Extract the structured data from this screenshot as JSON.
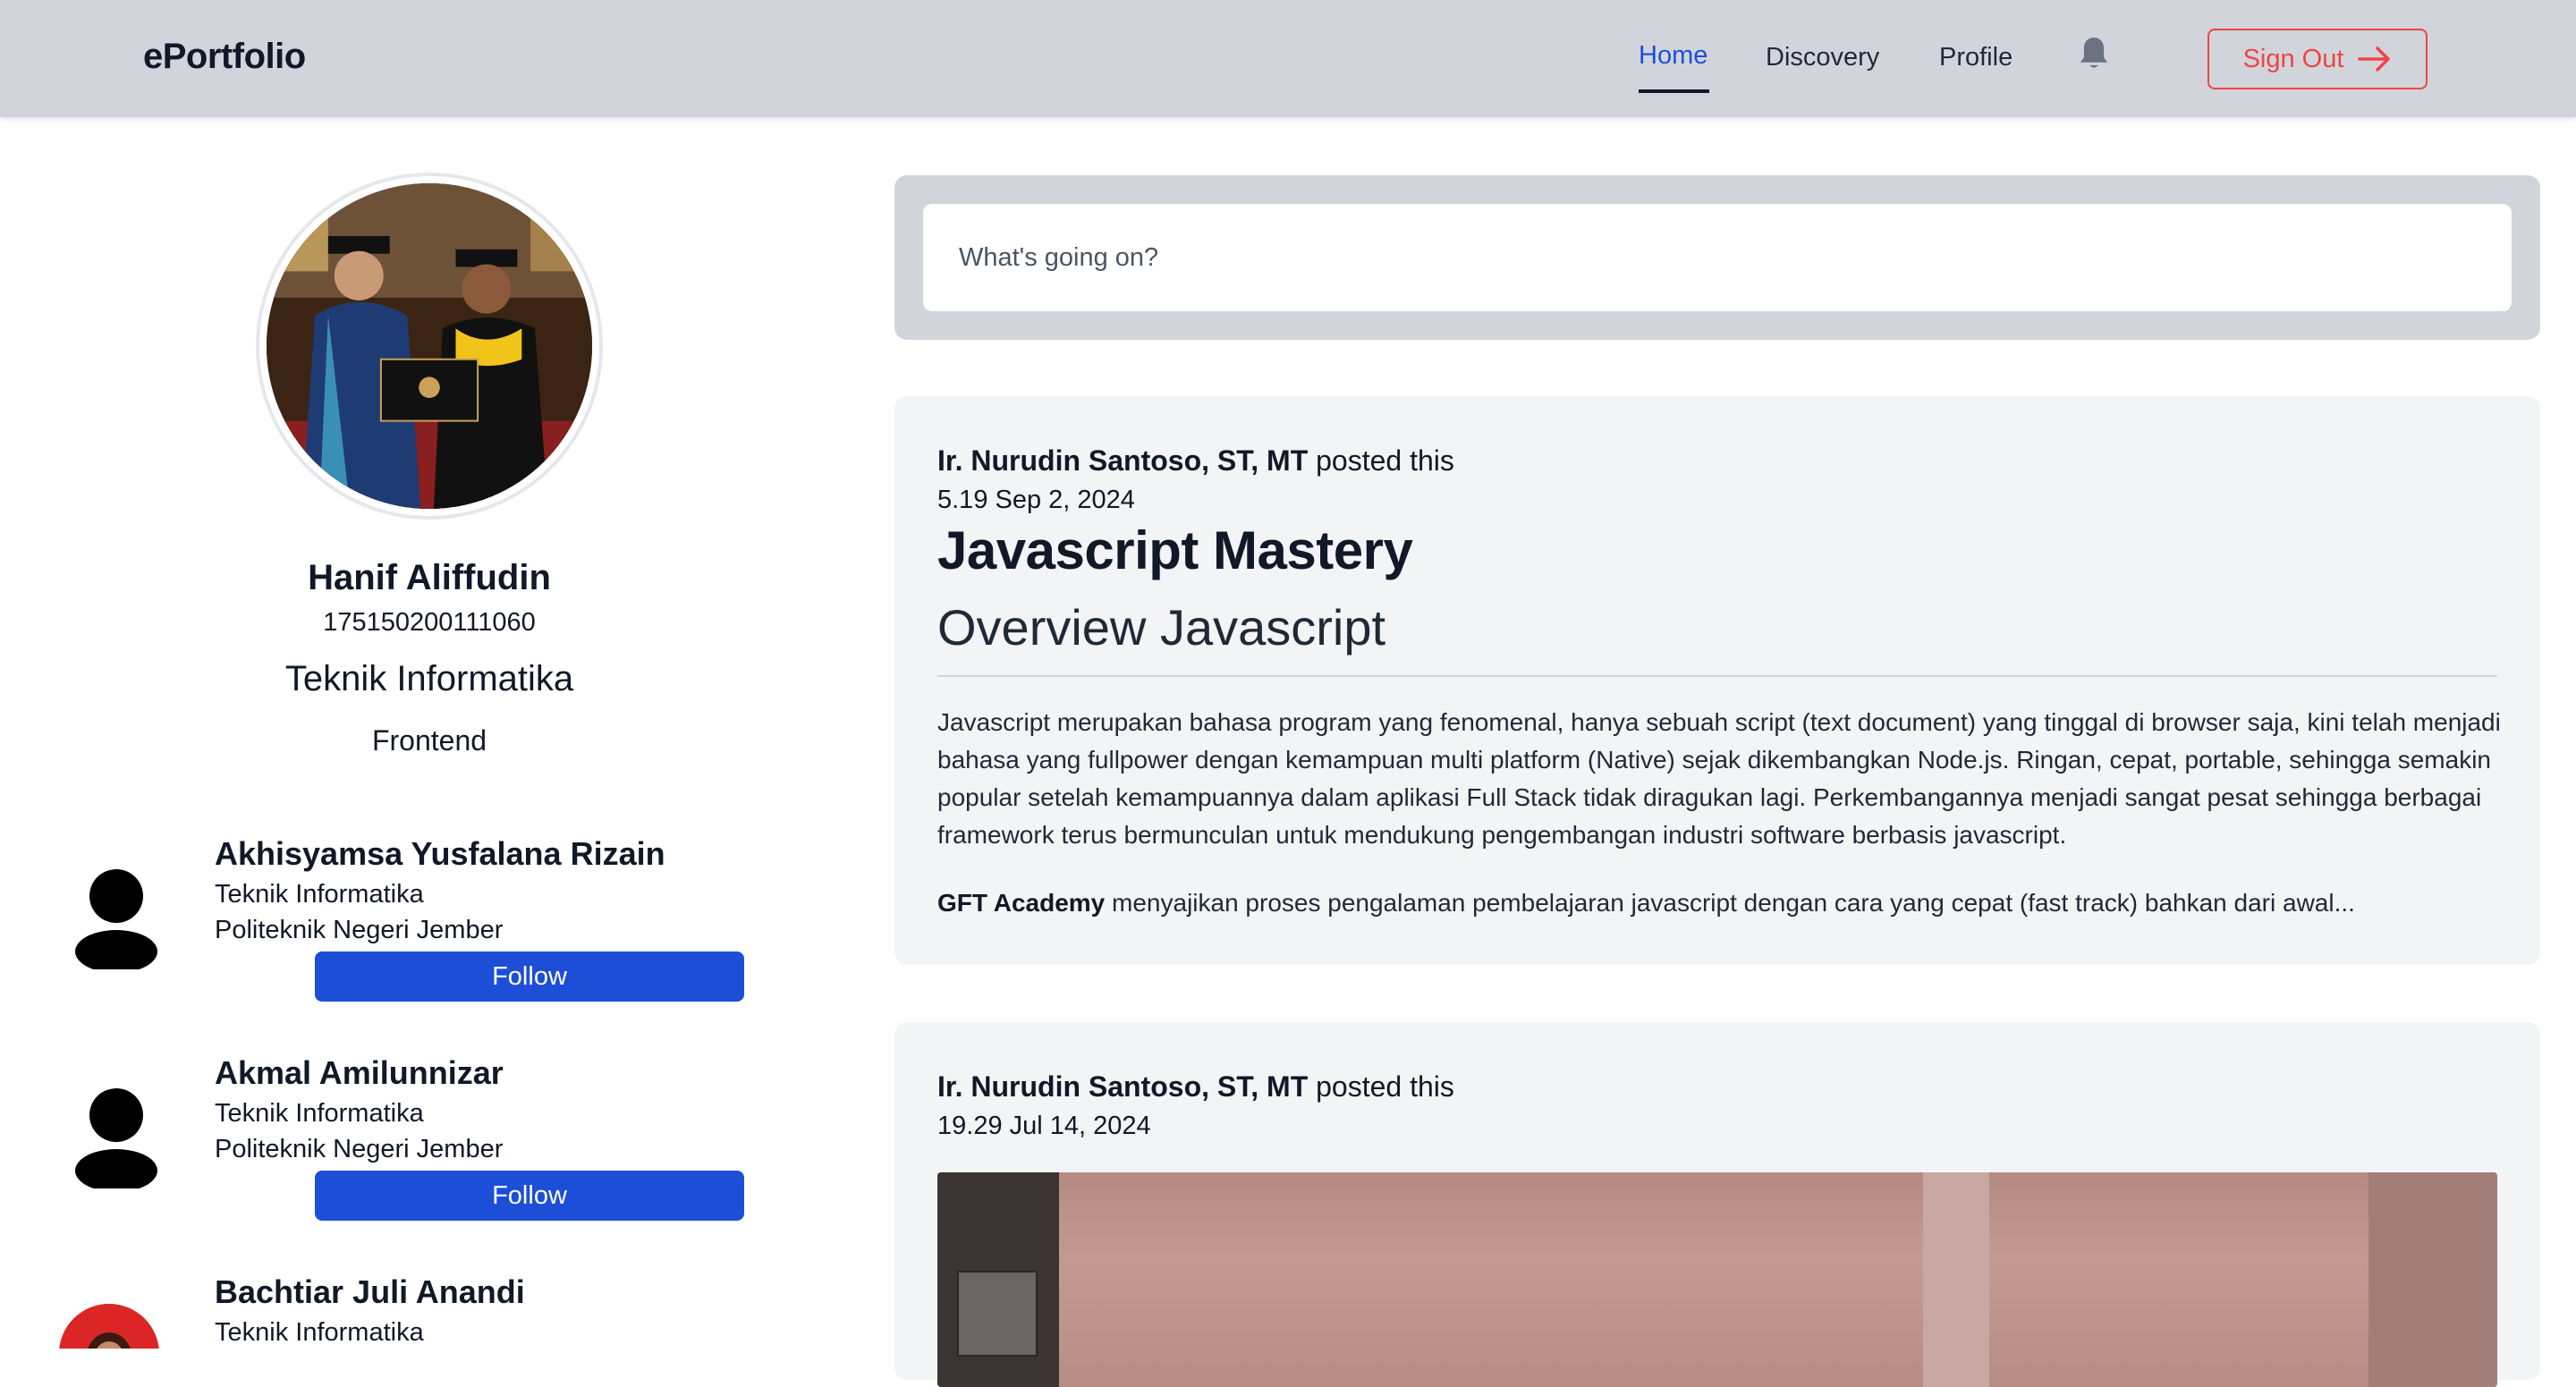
{
  "brand": "ePortfolio",
  "nav": {
    "home": "Home",
    "discovery": "Discovery",
    "profile": "Profile",
    "signout": "Sign Out"
  },
  "colors": {
    "navbar_bg": "#d1d5db",
    "accent": "#1d4ed8",
    "danger": "#ef4444",
    "card_bg": "#f3f4f6"
  },
  "profile": {
    "name": "Hanif Aliffudin",
    "nim": "175150200111060",
    "department": "Teknik Informatika",
    "role": "Frontend"
  },
  "suggestions": [
    {
      "name": "Akhisyamsa Yusfalana Rizain",
      "department": "Teknik Informatika",
      "school": "Politeknik Negeri Jember",
      "button": "Follow",
      "avatar": "default-user-icon"
    },
    {
      "name": "Akmal Amilunnizar",
      "department": "Teknik Informatika",
      "school": "Politeknik Negeri Jember",
      "button": "Follow",
      "avatar": "default-user-icon"
    },
    {
      "name": "Bachtiar Juli Anandi",
      "department": "Teknik Informatika",
      "avatar": "photo"
    }
  ],
  "composer": {
    "placeholder": "What's going on?"
  },
  "posts": [
    {
      "author": "Ir. Nurudin Santoso, ST, MT",
      "action": "posted this",
      "time": "5.19 Sep 2, 2024",
      "title": "Javascript Mastery",
      "subtitle": "Overview Javascript",
      "body": "Javascript merupakan bahasa program yang fenomenal, hanya sebuah script (text document) yang tinggal di browser saja, kini telah menjadi bahasa yang fullpower dengan kemampuan multi platform (Native) sejak dikembangkan Node.js. Ringan, cepat, portable, sehingga semakin popular setelah kemampuannya dalam aplikasi Full Stack tidak diragukan lagi. Perkembangannya menjadi sangat pesat sehingga berbagai framework terus bermunculan untuk mendukung pengembangan industri software berbasis javascript.",
      "body2_bold": "GFT Academy",
      "body2": " menyajikan proses pengalaman pembelajaran javascript dengan cara yang cepat (fast track) bahkan dari awal..."
    },
    {
      "author": "Ir. Nurudin Santoso, ST, MT",
      "action": "posted this",
      "time": "19.29 Jul 14, 2024"
    }
  ]
}
